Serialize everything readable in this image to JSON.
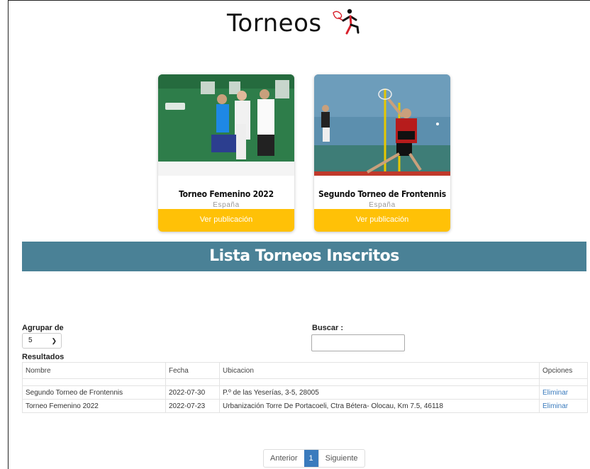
{
  "header": {
    "title": "Torneos",
    "logo_icon": "tennis-player-icon"
  },
  "cards": [
    {
      "title": "Torneo Femenino 2022",
      "country": "España",
      "button": "Ver publicación",
      "image": "women-tournament-photo"
    },
    {
      "title": "Segundo Torneo de Frontennis",
      "country": "España",
      "button": "Ver publicación",
      "image": "frontennis-player-photo"
    }
  ],
  "banner": {
    "title": "Lista Torneos Inscritos"
  },
  "controls": {
    "group_label": "Agrupar de",
    "group_value": "5",
    "search_label": "Buscar :",
    "search_value": "",
    "results_label": "Resultados"
  },
  "table": {
    "headers": [
      "Nombre",
      "Fecha",
      "Ubicacion",
      "Opciones"
    ],
    "rows": [
      {
        "name": "Segundo Torneo de Frontennis",
        "date": "2022-07-30",
        "location": "P.º de las Yeserías, 3-5, 28005",
        "action": "Eliminar"
      },
      {
        "name": "Torneo Femenino 2022",
        "date": "2022-07-23",
        "location": "Urbanización Torre De Portacoeli, Ctra Bétera- Olocau, Km 7.5, 46118",
        "action": "Eliminar"
      }
    ]
  },
  "pagination": {
    "prev": "Anterior",
    "current": "1",
    "next": "Siguiente"
  },
  "colors": {
    "banner": "#4a8196",
    "button": "#ffc107",
    "link": "#3a7bbd"
  }
}
